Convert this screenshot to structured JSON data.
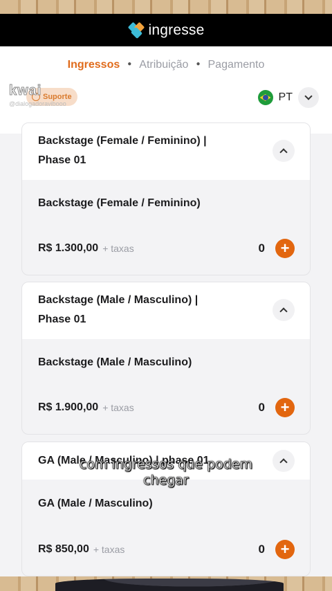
{
  "app": {
    "brand": "ingresse"
  },
  "steps": [
    {
      "label": "Ingressos",
      "active": true
    },
    {
      "label": "Atribuição",
      "active": false
    },
    {
      "label": "Pagamento",
      "active": false
    }
  ],
  "support": {
    "label": "Suporte"
  },
  "language": {
    "label": "PT",
    "flag": "brazil-flag-icon"
  },
  "watermark": {
    "logo": "kwai",
    "handle": "@dialogadoravibooo"
  },
  "tickets": [
    {
      "title_line1": "Backstage (Female / Feminino) |",
      "title_line2": "Phase 01",
      "name": "Backstage (Female / Feminino)",
      "price": "R$ 1.300,00",
      "taxes": "+ taxas",
      "quantity": "0"
    },
    {
      "title_line1": "Backstage (Male / Masculino) |",
      "title_line2": "Phase 01",
      "name": "Backstage (Male / Masculino)",
      "price": "R$ 1.900,00",
      "taxes": "+ taxas",
      "quantity": "0"
    },
    {
      "title_line1": "GA (Male / Masculino) | phase 01",
      "title_line2": "",
      "name": "GA (Male / Masculino)",
      "price": "R$ 850,00",
      "taxes": "+ taxas",
      "quantity": "0"
    }
  ],
  "caption": {
    "line1": "com ingressos que podem",
    "line2": "chegar"
  },
  "colors": {
    "accent": "#e2660f",
    "header": "#000000",
    "muted": "#9a9ca4"
  }
}
